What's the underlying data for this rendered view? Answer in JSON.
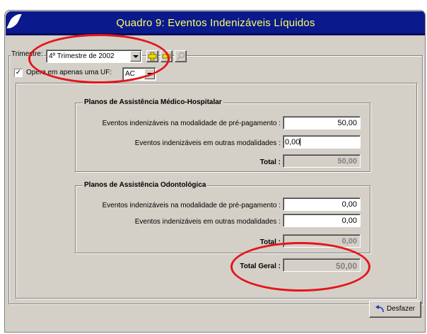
{
  "window": {
    "title": "Quadro 9: Eventos Indenizáveis Líquidos"
  },
  "trimestre": {
    "label": "Trimestre:",
    "selected": "4º Trimestre de 2002",
    "add_icon": "plus-icon",
    "remove_icon": "minus-icon",
    "search_icon": "magnifier-icon"
  },
  "uf": {
    "checkbox_label": "Opera em apenas uma UF:",
    "checked": true,
    "selected": "AC"
  },
  "medico": {
    "title": "Planos de Assistência Médico-Hospitalar",
    "pre_label": "Eventos indenizáveis na modalidade de pré-pagamento :",
    "pre_value": "50,00",
    "outras_label": "Eventos indenizáveis em outras modalidades :",
    "outras_value": "0,00",
    "total_label": "Total :",
    "total_value": "50,00"
  },
  "odonto": {
    "title": "Planos de Assistência Odontológica",
    "pre_label": "Eventos indenizáveis na modalidade de pré-pagamento :",
    "pre_value": "0,00",
    "outras_label": "Eventos indenizáveis em outras modalidades :",
    "outras_value": "0,00",
    "total_label": "Total :",
    "total_value": "0,00"
  },
  "total_geral": {
    "label": "Total Geral :",
    "value": "50,00"
  },
  "footer": {
    "undo_label": "Desfazer",
    "undo_icon": "undo-arrow-icon"
  },
  "colors": {
    "titlebar": "#0a1a8c",
    "title_text": "#ffff66",
    "window_bg": "#d4d0c8",
    "annotation": "#e4151b"
  }
}
